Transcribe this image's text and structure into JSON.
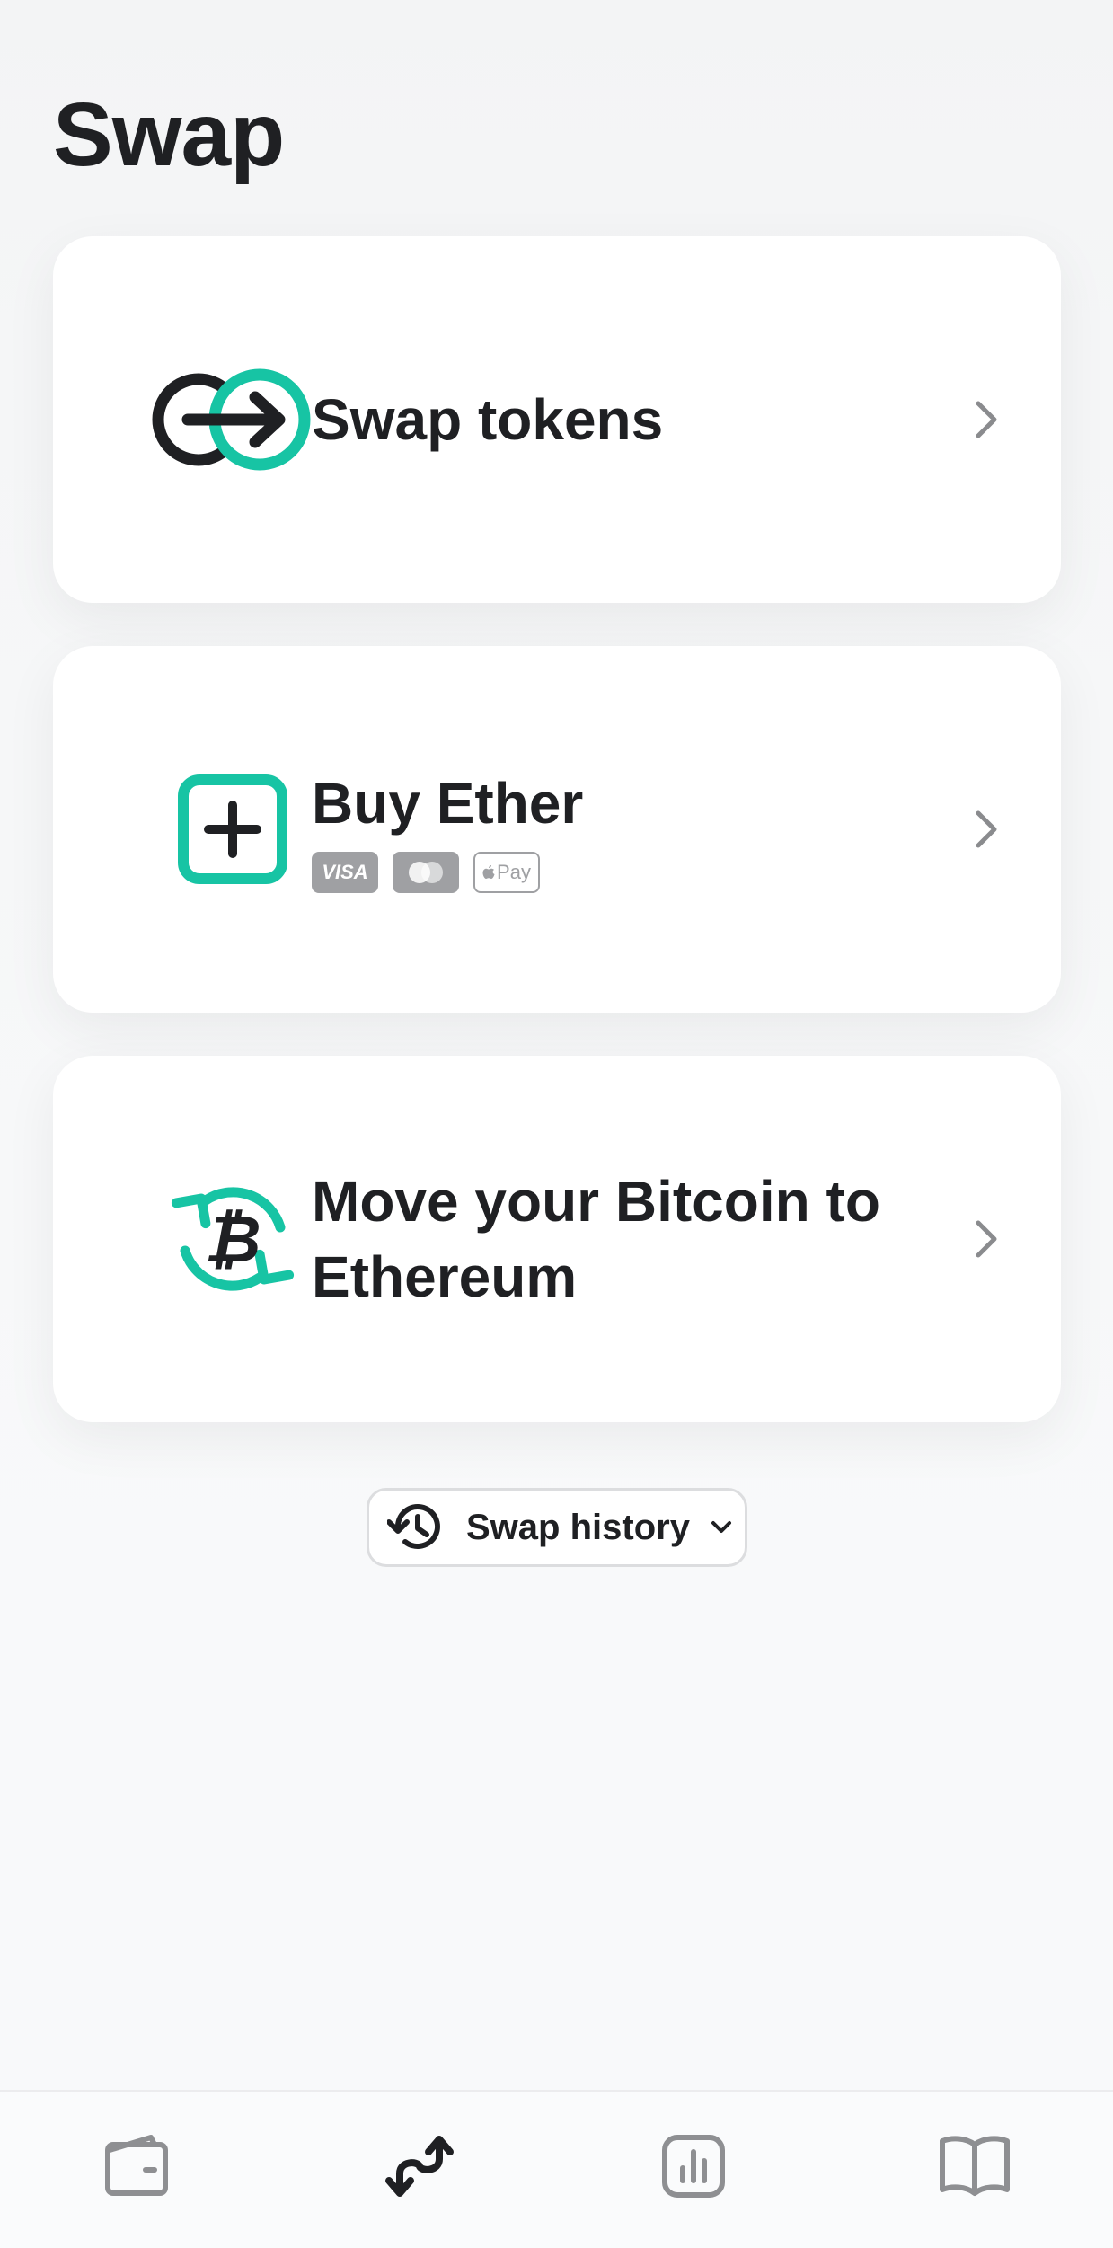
{
  "page": {
    "title": "Swap"
  },
  "options": [
    {
      "label": "Swap tokens",
      "icon": "swap-tokens-icon"
    },
    {
      "label": "Buy Ether",
      "icon": "plus-square-icon",
      "payment_methods": [
        "VISA",
        "Mastercard",
        "Pay"
      ]
    },
    {
      "label": "Move your Bitcoin to Ethereum",
      "icon": "bitcoin-refresh-icon"
    }
  ],
  "history": {
    "label": "Swap history",
    "icon": "history-icon"
  },
  "tabbar": {
    "items": [
      {
        "icon": "wallet-icon",
        "active": false
      },
      {
        "icon": "swap-arrows-icon",
        "active": true
      },
      {
        "icon": "bar-chart-icon",
        "active": false
      },
      {
        "icon": "book-icon",
        "active": false
      }
    ]
  },
  "colors": {
    "accent": "#17c4a4",
    "text": "#1f2023",
    "muted": "#8a8b8e",
    "background": "#f8f9fa"
  }
}
